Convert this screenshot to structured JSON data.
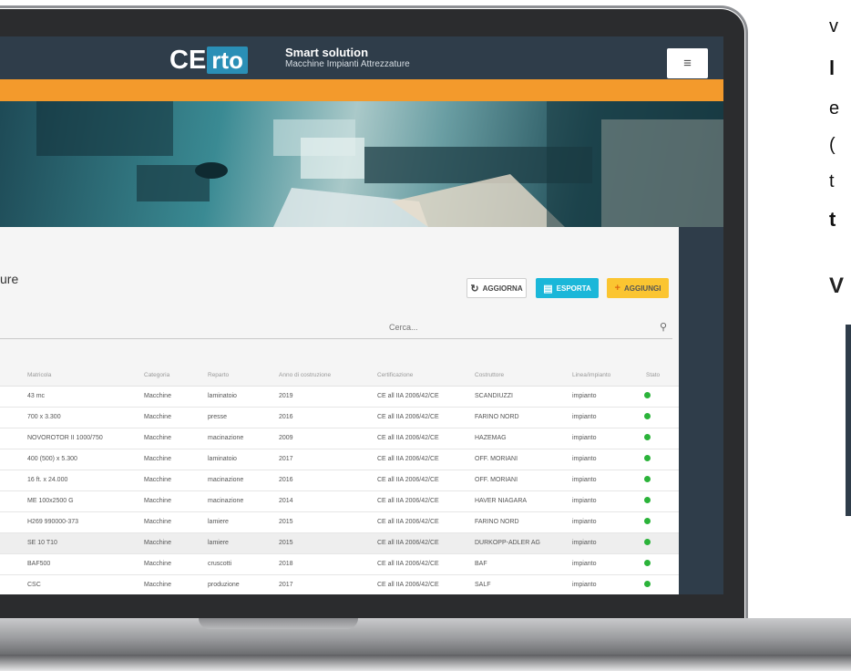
{
  "brand": {
    "logo_left": "CE",
    "logo_right": "rto",
    "tagline_title": "Smart solution",
    "tagline_sub": "Macchine Impianti Attrezzature"
  },
  "header": {
    "menu_icon": "hamburger-icon"
  },
  "page": {
    "title": "ure"
  },
  "toolbar": {
    "refresh_label": "AGGIORNA",
    "export_label": "ESPORTA",
    "add_label": "AGGIUNGI"
  },
  "search": {
    "placeholder": "Cerca..."
  },
  "table": {
    "headers": [
      "Matricola",
      "Categoria",
      "Reparto",
      "Anno di costruzione",
      "Certificazione",
      "Costruttore",
      "Linea/impianto",
      "Stato"
    ],
    "rows": [
      [
        "43 mc",
        "Macchine",
        "laminatoio",
        "2019",
        "CE all IIA 2006/42/CE",
        "SCANDIUZZI",
        "impianto"
      ],
      [
        "700 x 3.300",
        "Macchine",
        "presse",
        "2016",
        "CE all IIA 2006/42/CE",
        "FARINO NORD",
        "impianto"
      ],
      [
        "NOVOROTOR II 1000/750",
        "Macchine",
        "macinazione",
        "2009",
        "CE all IIA 2006/42/CE",
        "HAZEMAG",
        "impianto"
      ],
      [
        "400 (500) x 5.300",
        "Macchine",
        "laminatoio",
        "2017",
        "CE all IIA 2006/42/CE",
        "OFF. MORIANI",
        "impianto"
      ],
      [
        "16 ft. x 24.000",
        "Macchine",
        "macinazione",
        "2016",
        "CE all IIA 2006/42/CE",
        "OFF. MORIANI",
        "impianto"
      ],
      [
        "ME 100x2500 G",
        "Macchine",
        "macinazione",
        "2014",
        "CE all IIA 2006/42/CE",
        "HAVER NIAGARA",
        "impianto"
      ],
      [
        "H269 990000-373",
        "Macchine",
        "lamiere",
        "2015",
        "CE all IIA 2006/42/CE",
        "FARINO NORD",
        "impianto"
      ],
      [
        "SE 10 T10",
        "Macchine",
        "lamiere",
        "2015",
        "CE all IIA 2006/42/CE",
        "DURKOPP-ADLER AG",
        "impianto"
      ],
      [
        "BAF500",
        "Macchine",
        "cruscotti",
        "2018",
        "CE all IIA 2006/42/CE",
        "BAF",
        "impianto"
      ],
      [
        "CSC",
        "Macchine",
        "produzione",
        "2017",
        "CE all IIA 2006/42/CE",
        "SALF",
        "impianto"
      ]
    ],
    "status_color": "#2bb33a"
  },
  "right_text": [
    "v",
    "l",
    "e",
    "(",
    "t",
    "t",
    "V"
  ],
  "colors": {
    "header": "#2f3d4a",
    "orange": "#f39a2c",
    "logo_accent": "#2a8fb6",
    "export": "#1ab7d9",
    "add": "#fbc531"
  }
}
